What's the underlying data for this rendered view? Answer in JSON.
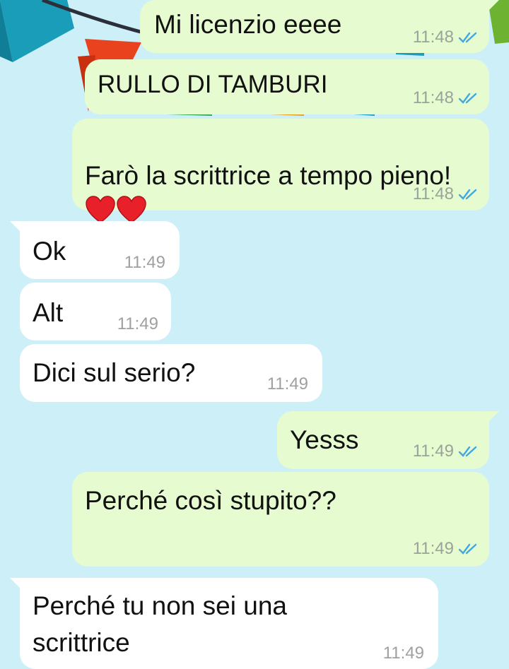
{
  "chat": {
    "colors": {
      "background": "#cdeff7",
      "outgoing_bubble": "#e6fbd0",
      "incoming_bubble": "#ffffff",
      "read_ticks": "#3fa9e6"
    },
    "messages": [
      {
        "direction": "outgoing",
        "text": "Mi licenzio eeee",
        "time": "11:48",
        "status": "read"
      },
      {
        "direction": "outgoing",
        "text": "RULLO DI TAMBURI",
        "time": "11:48",
        "status": "read"
      },
      {
        "direction": "outgoing",
        "text": "Farò la scrittrice a tempo pieno! ",
        "emoji": "red-heart-icon x2",
        "time": "11:48",
        "status": "read"
      },
      {
        "direction": "incoming",
        "text": "Ok",
        "time": "11:49"
      },
      {
        "direction": "incoming",
        "text": "Alt",
        "time": "11:49"
      },
      {
        "direction": "incoming",
        "text": "Dici sul serio?",
        "time": "11:49"
      },
      {
        "direction": "outgoing",
        "text": "Yesss",
        "time": "11:49",
        "status": "read"
      },
      {
        "direction": "outgoing",
        "text": "Perché così stupito??",
        "time": "11:49",
        "status": "read"
      },
      {
        "direction": "incoming",
        "text": "Perché tu non sei una scrittrice",
        "time": "11:49"
      }
    ]
  }
}
